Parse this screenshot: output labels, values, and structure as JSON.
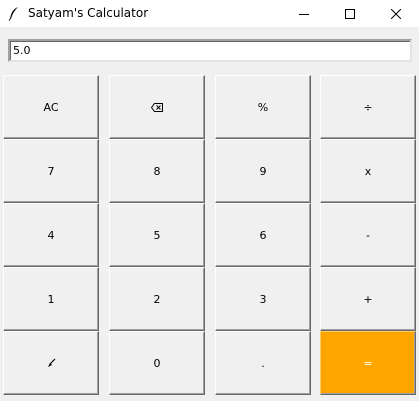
{
  "window": {
    "title": "Satyam's Calculator",
    "controls": [
      "minimize",
      "maximize",
      "close"
    ]
  },
  "display": {
    "value": "5.0"
  },
  "keypad": {
    "rows": [
      [
        {
          "label": "AC",
          "name": "clear-button"
        },
        {
          "label": "",
          "name": "backspace-button",
          "icon": "backspace-icon"
        },
        {
          "label": "%",
          "name": "percent-button"
        },
        {
          "label": "÷",
          "name": "divide-button"
        }
      ],
      [
        {
          "label": "7",
          "name": "digit-7-button"
        },
        {
          "label": "8",
          "name": "digit-8-button"
        },
        {
          "label": "9",
          "name": "digit-9-button"
        },
        {
          "label": "x",
          "name": "multiply-button"
        }
      ],
      [
        {
          "label": "4",
          "name": "digit-4-button"
        },
        {
          "label": "5",
          "name": "digit-5-button"
        },
        {
          "label": "6",
          "name": "digit-6-button"
        },
        {
          "label": "-",
          "name": "subtract-button"
        }
      ],
      [
        {
          "label": "1",
          "name": "digit-1-button"
        },
        {
          "label": "2",
          "name": "digit-2-button"
        },
        {
          "label": "3",
          "name": "digit-3-button"
        },
        {
          "label": "+",
          "name": "add-button"
        }
      ],
      [
        {
          "label": "",
          "name": "pointer-button",
          "icon": "pencil-icon"
        },
        {
          "label": "0",
          "name": "digit-0-button"
        },
        {
          "label": ".",
          "name": "decimal-button"
        },
        {
          "label": "=",
          "name": "equals-button"
        }
      ]
    ]
  },
  "colors": {
    "equals_background": "#ffa500",
    "equals_text": "#ffffff",
    "button_face": "#f0f0f0"
  }
}
